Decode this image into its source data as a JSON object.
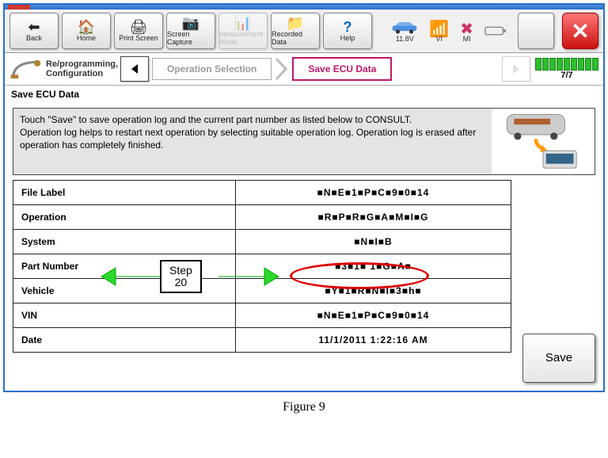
{
  "toolbar": {
    "back": "Back",
    "home": "Home",
    "print": "Print Screen",
    "capture": "Screen Capture",
    "measure": "Measurement Mode",
    "recorded": "Recorded Data",
    "help": "Help"
  },
  "status": {
    "voltage": "11.8V",
    "vi": "VI",
    "mi": "MI"
  },
  "breadcrumb": {
    "mode": "Re/programming, Configuration",
    "step_prev": "Operation Selection",
    "step_current": "Save ECU Data",
    "progress": "7/7"
  },
  "subheading": "Save ECU Data",
  "instructions": "Touch \"Save\" to save operation log and the current part number as listed below to CONSULT.\nOperation log helps to restart next operation by selecting suitable operation log. Operation log is erased after operation has completely finished.",
  "table": {
    "rows": [
      {
        "label": "File Label",
        "value": "■N■E■1■P■C■9■0■14"
      },
      {
        "label": "Operation",
        "value": "■R■P■R■G■A■M■I■G"
      },
      {
        "label": "System",
        "value": "■N■I■B"
      },
      {
        "label": "Part Number",
        "value": "■3■1■ 1■G■A■"
      },
      {
        "label": "Vehicle",
        "value": "■Y■1■R■N■I■3■h■"
      },
      {
        "label": "VIN",
        "value": "■N■E■1■P■C■9■0■14"
      },
      {
        "label": "Date",
        "value": "11/1/2011 1:22:16 AM"
      }
    ]
  },
  "annotation": {
    "step_label": "Step 20"
  },
  "save_label": "Save",
  "figure_caption": "Figure 9"
}
